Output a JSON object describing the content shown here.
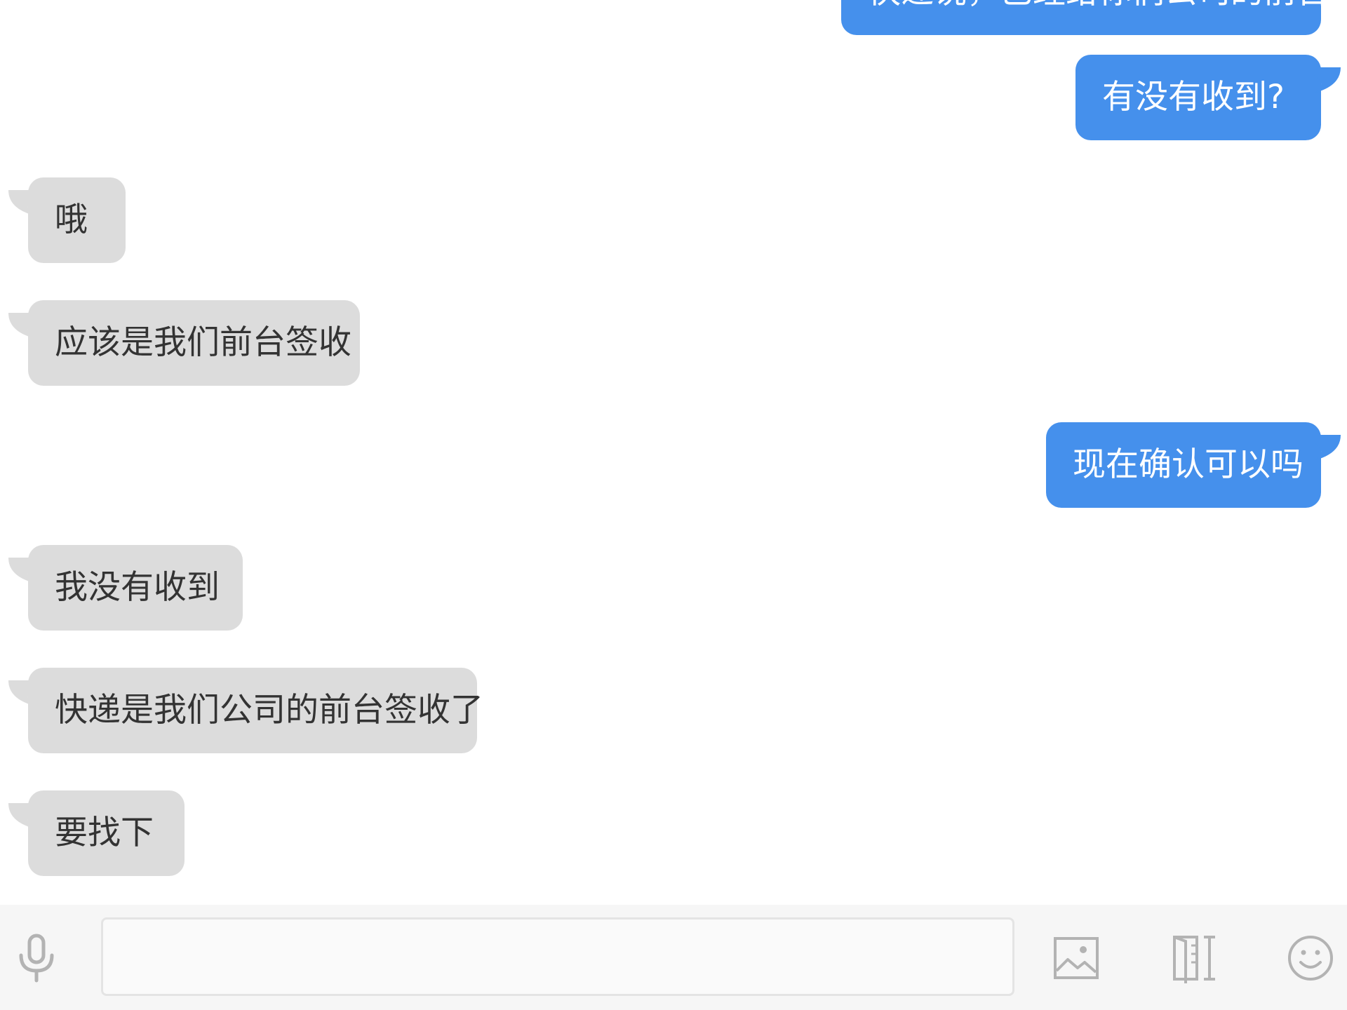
{
  "conversation": {
    "messages": [
      {
        "direction": "out",
        "text": "快递说，已经给你们公司的前台"
      },
      {
        "direction": "out",
        "text": "有没有收到?"
      },
      {
        "direction": "in",
        "text": "哦"
      },
      {
        "direction": "in",
        "text": "应该是我们前台签收"
      },
      {
        "direction": "out",
        "text": "现在确认可以吗"
      },
      {
        "direction": "in",
        "text": "我没有收到"
      },
      {
        "direction": "in",
        "text": "快递是我们公司的前台签收了"
      },
      {
        "direction": "in",
        "text": "要找下"
      }
    ]
  },
  "input_bar": {
    "message_value": "",
    "voice_icon": "microphone-icon",
    "image_icon": "image-icon",
    "doc_icon": "document-icon",
    "emoji_icon": "smiley-icon"
  },
  "colors": {
    "outgoing_bubble": "#4590ec",
    "incoming_bubble": "#dcdcdc",
    "incoming_text": "#333333",
    "icon_gray": "#b3b3b3"
  }
}
